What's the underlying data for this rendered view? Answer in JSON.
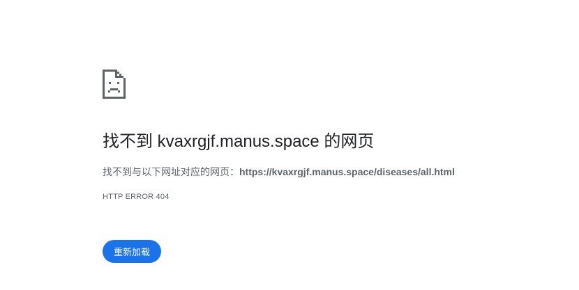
{
  "error_page": {
    "icon": "sad-document-icon",
    "headline": "找不到 kvaxrgjf.manus.space 的网页",
    "detail_prefix": "找不到与以下网址对应的网页：",
    "detail_url": "https://kvaxrgjf.manus.space/diseases/all.html",
    "error_code": "HTTP ERROR 404",
    "reload_label": "重新加载"
  },
  "colors": {
    "accent": "#1a73e8",
    "text_primary": "#202124",
    "text_secondary": "#5f6368"
  }
}
